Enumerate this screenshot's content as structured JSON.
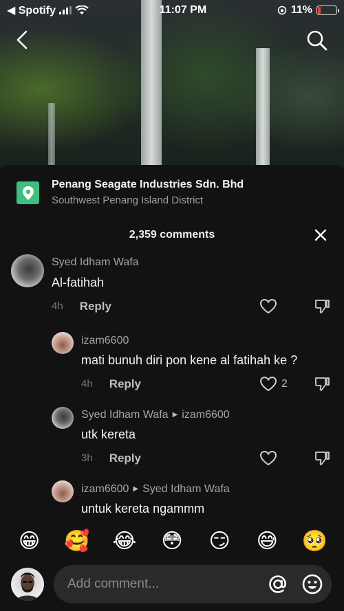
{
  "status_bar": {
    "back_app": "◀ Spotify",
    "time": "11:07 PM",
    "battery": "11%"
  },
  "location": {
    "title": "Penang Seagate Industries Sdn. Bhd",
    "subtitle": "Southwest Penang Island District"
  },
  "comments_count": "2,359 comments",
  "comments": [
    {
      "name": "Syed Idham Wafa",
      "text": "Al-fatihah",
      "time": "4h",
      "reply": "Reply",
      "likes": ""
    },
    {
      "name": "izam6600",
      "text": "mati bunuh diri pon kene al fatihah ke ?",
      "time": "4h",
      "reply": "Reply",
      "likes": "2"
    },
    {
      "name": "Syed Idham Wafa",
      "reply_to": "izam6600",
      "text": "utk kereta",
      "time": "3h",
      "reply": "Reply",
      "likes": ""
    },
    {
      "name": "izam6600",
      "reply_to": "Syed Idham Wafa",
      "text": "untuk kereta ngammm",
      "time": "",
      "reply": "",
      "likes": ""
    }
  ],
  "emojis": [
    "😁",
    "🥰",
    "😂",
    "😳",
    "😏",
    "😅",
    "🥺"
  ],
  "input": {
    "placeholder": "Add comment..."
  },
  "colors": {
    "sheet_bg": "#121212",
    "location_icon": "#3fbf7f",
    "battery_low": "#ff3b30"
  }
}
